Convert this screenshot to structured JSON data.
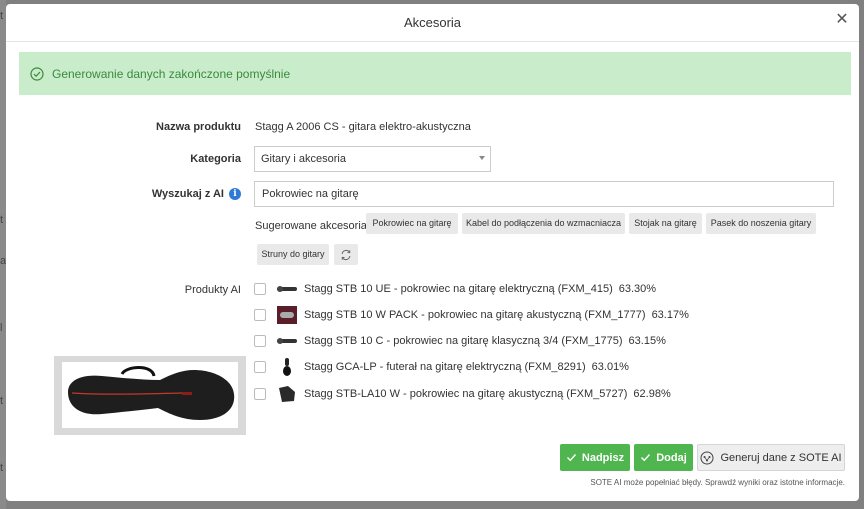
{
  "modal": {
    "title": "Akcesoria"
  },
  "alert": {
    "message": "Generowanie danych zakończone pomyślnie"
  },
  "form": {
    "product_name_label": "Nazwa produktu",
    "product_name_value": "Stagg A 2006 CS - gitara elektro-akustyczna",
    "category_label": "Kategoria",
    "category_value": "Gitary i akcesoria",
    "search_label": "Wyszukaj z AI",
    "search_value": "Pokrowiec na gitarę",
    "suggested_label": "Sugerowane akcesoria:",
    "suggestions": [
      "Pokrowiec na gitarę",
      "Kabel do podłączenia do wzmacniacza",
      "Stojak na gitarę",
      "Pasek do noszenia gitary",
      "Struny do gitary"
    ],
    "ai_products_label": "Produkty AI"
  },
  "products": [
    {
      "name": "Stagg STB 10 UE - pokrowiec na gitarę elektryczną (FXM_415)",
      "score": "63.30%"
    },
    {
      "name": "Stagg STB 10 W PACK - pokrowiec na gitarę akustyczną (FXM_1777)",
      "score": "63.17%"
    },
    {
      "name": "Stagg STB 10 C - pokrowiec na gitarę klasyczną 3/4 (FXM_1775)",
      "score": "63.15%"
    },
    {
      "name": "Stagg GCA-LP - futerał na gitarę elektryczną (FXM_8291)",
      "score": "63.01%"
    },
    {
      "name": "Stagg STB-LA10 W - pokrowiec na gitarę akustyczną (FXM_5727)",
      "score": "62.98%"
    }
  ],
  "buttons": {
    "overwrite": "Nadpisz",
    "add": "Dodaj",
    "generate": "Generuj dane z SOTE AI"
  },
  "disclaimer": "SOTE AI może popełniać błędy. Sprawdź wyniki oraz istotne informacje.",
  "background_fragments": [
    "t",
    "t",
    "a",
    "l",
    "t",
    "t"
  ],
  "colors": {
    "success_bg": "#c9ecca",
    "success_text": "#3b8a3e",
    "primary_green": "#4fb54f",
    "info_blue": "#2f7ad6"
  }
}
